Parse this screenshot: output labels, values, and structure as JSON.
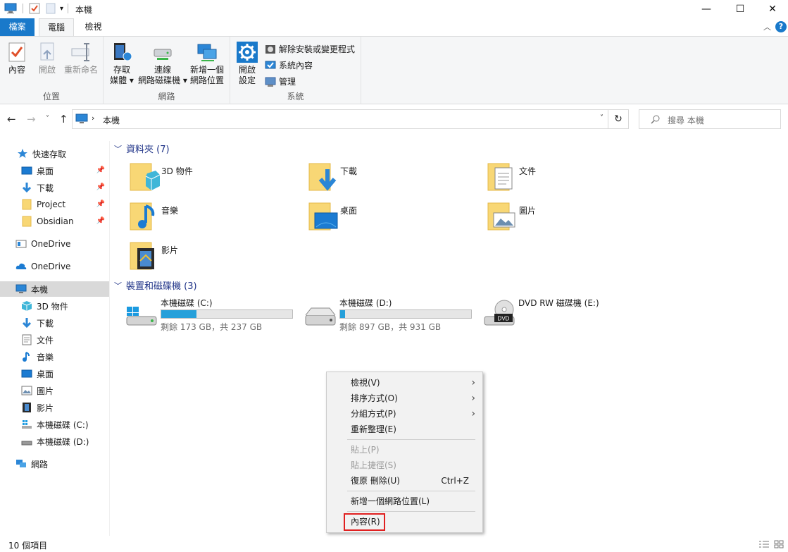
{
  "window": {
    "title": "本機",
    "minimize_icon": "—",
    "maximize_icon": "☐",
    "close_icon": "✕"
  },
  "ribbon_tabs": {
    "file": "檔案",
    "computer": "電腦",
    "view": "檢視"
  },
  "ribbon": {
    "location_group": {
      "label": "位置",
      "properties": "內容",
      "open": "開啟",
      "rename": "重新命名"
    },
    "network_group": {
      "label": "網路",
      "access_media_1": "存取",
      "access_media_2": "媒體 ▾",
      "map_drive_1": "連線",
      "map_drive_2": "網路磁碟機 ▾",
      "add_location_1": "新增一個",
      "add_location_2": "網路位置"
    },
    "system_group": {
      "label": "系統",
      "open_settings_1": "開啟",
      "open_settings_2": "設定",
      "uninstall": "解除安裝或變更程式",
      "system_properties": "系統內容",
      "manage": "管理"
    }
  },
  "address_bar": {
    "path": "本機",
    "search_placeholder": "搜尋 本機"
  },
  "sidebar": {
    "quick_access": "快速存取",
    "items": [
      {
        "label": "桌面",
        "pinned": true
      },
      {
        "label": "下載",
        "pinned": true
      },
      {
        "label": "Project",
        "pinned": true
      },
      {
        "label": "Obsidian",
        "pinned": true
      }
    ],
    "onedrive1": "OneDrive",
    "onedrive2": "OneDrive",
    "this_pc": "本機",
    "pc_items": [
      "3D 物件",
      "下載",
      "文件",
      "音樂",
      "桌面",
      "圖片",
      "影片",
      "本機磁碟 (C:)",
      "本機磁碟 (D:)"
    ],
    "network": "網路"
  },
  "folders_section": {
    "header": "資料夾 (7)",
    "items": [
      "3D 物件",
      "下載",
      "文件",
      "音樂",
      "桌面",
      "圖片",
      "影片"
    ]
  },
  "drives_section": {
    "header": "裝置和磁碟機 (3)",
    "drives": [
      {
        "name": "本機磁碟 (C:)",
        "free_text": "剩餘 173 GB，共 237 GB",
        "used_fraction": 0.27
      },
      {
        "name": "本機磁碟 (D:)",
        "free_text": "剩餘 897 GB，共 931 GB",
        "used_fraction": 0.037
      },
      {
        "name": "DVD RW 磁碟機 (E:)"
      }
    ],
    "dvd_label": "DVD"
  },
  "context_menu": {
    "view": "檢視(V)",
    "sort": "排序方式(O)",
    "group": "分組方式(P)",
    "refresh": "重新整理(E)",
    "paste": "貼上(P)",
    "paste_shortcut": "貼上捷徑(S)",
    "undo": "復原 刪除(U)",
    "undo_shortcut": "Ctrl+Z",
    "add_network_location": "新增一個網路位置(L)",
    "properties": "內容(R)"
  },
  "status_bar": {
    "item_count": "10 個項目"
  },
  "colors": {
    "accent": "#1979ca",
    "folder": "#f8d775",
    "drive_bar": "#26a0da",
    "highlight_border": "#e02020"
  }
}
